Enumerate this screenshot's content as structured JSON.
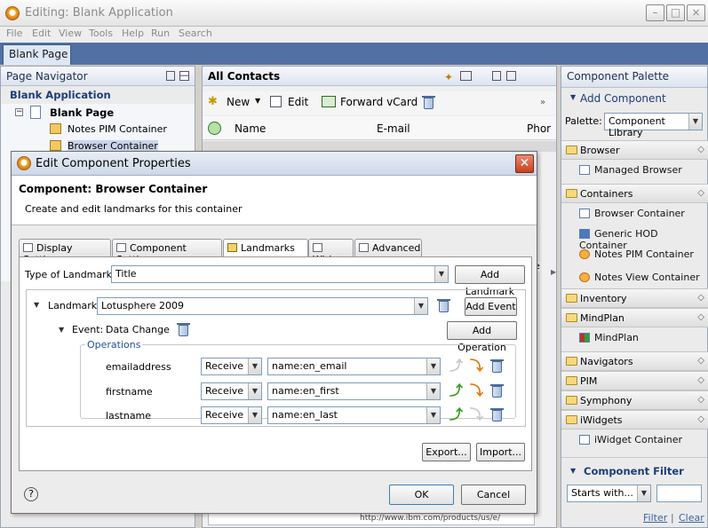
{
  "window": {
    "title": "Editing: Blank Application"
  },
  "menu": [
    "File",
    "Edit",
    "View",
    "Tools",
    "Help",
    "Run",
    "Search"
  ],
  "page_tab": "Blank Page",
  "navigator": {
    "title": "Page Navigator",
    "app": "Blank Application",
    "tree": [
      "Blank Page",
      "Notes PIM Container",
      "Browser Container"
    ]
  },
  "contacts": {
    "title": "All Contacts",
    "toolbar": {
      "new": "New",
      "edit": "Edit",
      "forward": "Forward vCard"
    },
    "columns": [
      "Name",
      "E-mail",
      "Phor"
    ],
    "url_fragment": "http://www.ibm.com/products/us/e/",
    "side_fragment": "n/e"
  },
  "palette": {
    "title": "Component Palette",
    "add": "Add Component",
    "palette_label": "Palette:",
    "palette_value": "Component Library",
    "categories": [
      {
        "name": "Browser",
        "items": [
          "Managed Browser"
        ]
      },
      {
        "name": "Containers",
        "items": [
          "Browser Container",
          "Generic HOD Container",
          "Notes PIM Container",
          "Notes View Container"
        ]
      },
      {
        "name": "Inventory",
        "items": []
      },
      {
        "name": "MindPlan",
        "items": [
          "MindPlan"
        ]
      },
      {
        "name": "Navigators",
        "items": []
      },
      {
        "name": "PIM",
        "items": []
      },
      {
        "name": "Symphony",
        "items": []
      },
      {
        "name": "iWidgets",
        "items": [
          "iWidget Container"
        ]
      }
    ],
    "filter": {
      "title": "Component Filter",
      "mode": "Starts with...",
      "value": "",
      "filter_link": "Filter",
      "divider": "|",
      "clear_link": "Clear"
    }
  },
  "dialog": {
    "title": "Edit Component Properties",
    "header": "Component: Browser Container",
    "description": "Create and edit landmarks for this container",
    "tabs": [
      "Display Settings",
      "Component Settings",
      "Landmarks",
      "Wiring",
      "Advanced"
    ],
    "active_tab": "Landmarks",
    "type_label": "Type of Landmark:",
    "type_value": "Title",
    "add_landmark": "Add Landmark",
    "landmark_label": "Landmark:",
    "landmark_value": "Lotusphere 2009",
    "add_event": "Add Event",
    "event_label": "Event:",
    "event_value": "Data Change",
    "add_operation": "Add Operation",
    "operations_label": "Operations",
    "operations": [
      {
        "name": "emailaddress",
        "mode": "Receive",
        "target": "name:en_email"
      },
      {
        "name": "firstname",
        "mode": "Receive",
        "target": "name:en_first"
      },
      {
        "name": "lastname",
        "mode": "Receive",
        "target": "name:en_last"
      }
    ],
    "export": "Export...",
    "import": "Import...",
    "help": "?",
    "ok": "OK",
    "cancel": "Cancel"
  }
}
